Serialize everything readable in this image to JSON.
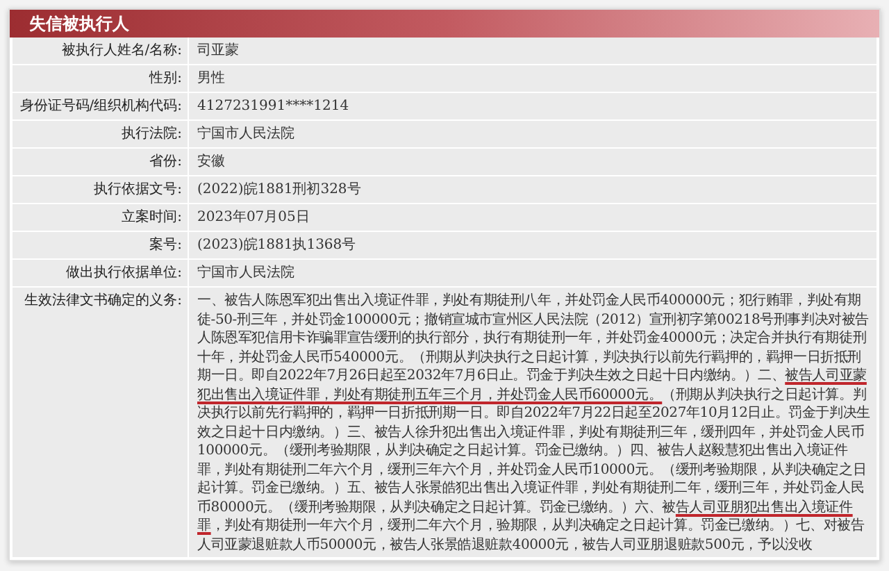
{
  "panel": {
    "title": "失信被执行人"
  },
  "fields": [
    {
      "label": "被执行人姓名/名称:",
      "value": "司亚蒙"
    },
    {
      "label": "性别:",
      "value": "男性"
    },
    {
      "label": "身份证号码/组织机构代码:",
      "value": "4127231991****1214"
    },
    {
      "label": "执行法院:",
      "value": "宁国市人民法院"
    },
    {
      "label": "省份:",
      "value": "安徽"
    },
    {
      "label": "执行依据文号:",
      "value": "(2022)皖1881刑初328号"
    },
    {
      "label": "立案时间:",
      "value": "2023年07月05日"
    },
    {
      "label": "案号:",
      "value": "(2023)皖1881执1368号"
    },
    {
      "label": "做出执行依据单位:",
      "value": "宁国市人民法院"
    }
  ],
  "duty": {
    "label": "生效法律文书确定的义务:",
    "segments": [
      {
        "text": "一、被告人陈恩军犯出售出入境证件罪，判处有期徒刑八年，并处罚金人民币400000元；犯行贿罪，判处有期徒-50-刑三年，并处罚金100000元；撤销宣城市宣州区人民法院（2012）宣刑初字第00218号刑事判决对被告人陈恩军犯信用卡诈骗罪宣告缓刑的执行部分，执行有期徒刑一年，并处罚金40000元；决定合并执行有期徒刑十年，并处罚金人民币540000元。（刑期从判决执行之日起计算，判决执行以前先行羁押的，羁押一日折抵刑期一日。即自2022年7月26日起至2032年7月6日止。罚金于判决生效之日起十日内缴纳。）二、",
        "underlined": false
      },
      {
        "text": "被告人司亚蒙犯出售出入境证件罪，判处有期徒刑五年三个月，并处罚金人民币60000元。",
        "underlined": true
      },
      {
        "text": "（刑期从判决执行之日起计算。判决执行以前先行羁押的，羁押一日折抵刑期一日。即自2022年7月22日起至2027年10月12日止。罚金于判决生效之日起十日内缴纳。）三、被告人徐升犯出售出入境证件罪，判处有期徒刑三年，缓刑四年，并处罚金人民币100000元。（缓刑考验期限，从判决确定之日起计算。罚金已缴纳。）四、被告人赵毅慧犯出售出入境证件罪，判处有期徒刑二年六个月，缓刑三年六个月，并处罚金人民币10000元。（缓刑考验期限，从判决确定之日起计算。罚金已缴纳。）五、被告人张景皓犯出售出入境证件罪，判处有期徒刑二年，缓刑三年，并处罚金人民币80000元。（缓刑考验期限，从判决确定之日起计算。罚金已缴纳。）六、被",
        "underlined": false
      },
      {
        "text": "告人司亚朋犯出售出入境证件罪",
        "underlined": true
      },
      {
        "text": "，判处有期徒刑一年六个月，缓刑二年六个月，验期限，从判决确定之日起计算。罚金已缴纳。）七、对被告人司亚蒙退赃款人币50000元，被告人张景皓退赃款40000元，被告人司亚朋退赃款500元，予以没收",
        "underlined": false
      }
    ]
  }
}
